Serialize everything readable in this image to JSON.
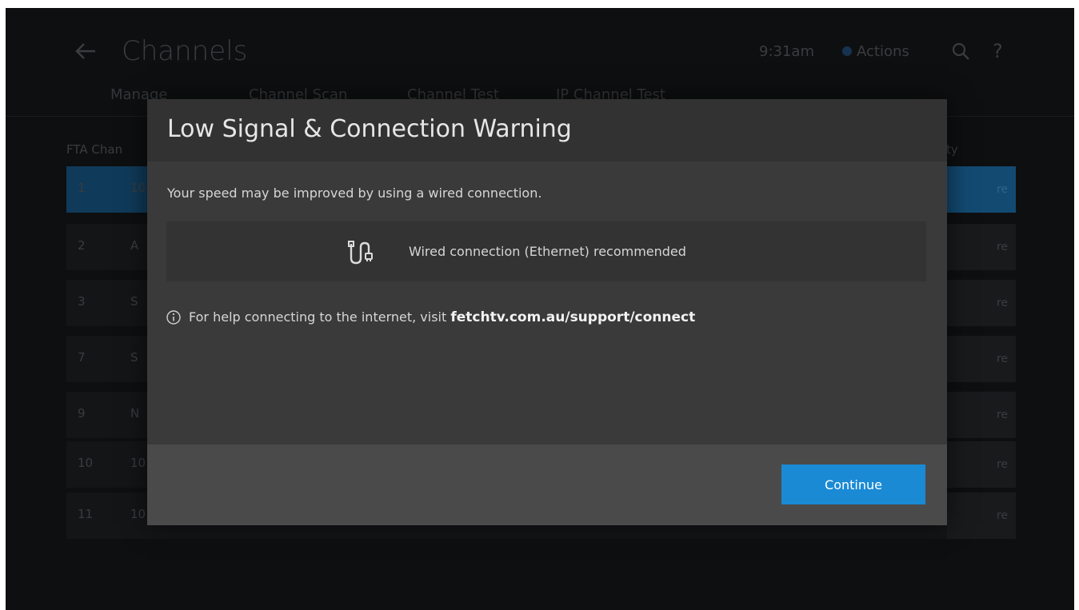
{
  "background": {
    "title": "Channels",
    "time": "9:31am",
    "actions_label": "Actions",
    "help_glyph": "?",
    "tabs": [
      "Manage",
      "Channel Scan",
      "Channel Test",
      "IP Channel Test"
    ],
    "column_left": "FTA Chan",
    "column_right": "ty",
    "rows": [
      {
        "num": "1",
        "name": "10",
        "action": "re"
      },
      {
        "num": "2",
        "name": "A",
        "action": "re"
      },
      {
        "num": "3",
        "name": "S",
        "action": "re"
      },
      {
        "num": "7",
        "name": "S",
        "action": "re"
      },
      {
        "num": "9",
        "name": "N",
        "action": "re"
      },
      {
        "num": "10",
        "name": "10",
        "action": "re"
      },
      {
        "num": "11",
        "name": "10",
        "action": "re"
      }
    ]
  },
  "modal": {
    "title": "Low Signal & Connection Warning",
    "speed_message": "Your speed may be improved by using a wired connection.",
    "wired_label": "Wired connection (Ethernet) recommended",
    "help_prefix": "For help connecting to the internet, visit ",
    "help_link": "fetchtv.com.au/support/connect",
    "continue_label": "Continue"
  },
  "colors": {
    "accent": "#1a8ad5",
    "selected_row": "#103a5a",
    "modal_bg": "#3a3a3a"
  }
}
